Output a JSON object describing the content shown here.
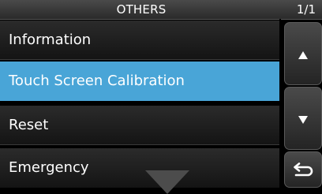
{
  "header": {
    "title": "OTHERS",
    "page": "1/1"
  },
  "menu": {
    "items": [
      {
        "label": "Information"
      },
      {
        "label": "Touch Screen Calibration",
        "selected": true
      },
      {
        "label": "Reset"
      },
      {
        "label": "Emergency"
      }
    ],
    "more_indicator_icon": "triangle-down"
  },
  "scroll": {
    "up_icon": "triangle-up",
    "down_icon": "triangle-down",
    "back_icon": "return-arrow"
  },
  "colors": {
    "selected": "#49a5d7",
    "background": "#000000"
  }
}
